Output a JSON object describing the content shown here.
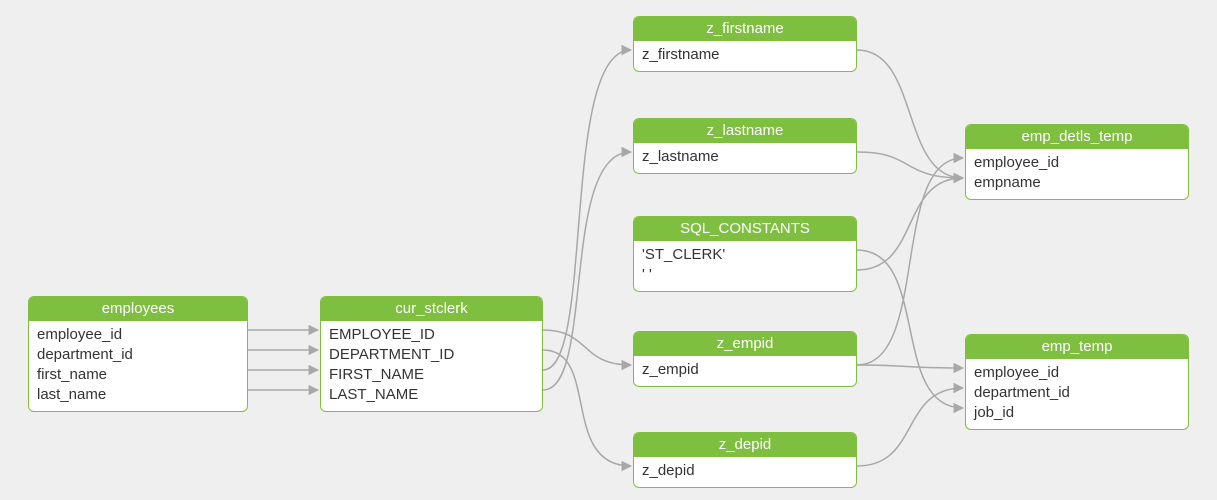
{
  "colors": {
    "node_header": "#7fbf3f",
    "node_border": "#7fbf3f",
    "connector": "#a8a8a8",
    "canvas_bg": "#efefef"
  },
  "nodes": {
    "employees": {
      "title": "employees",
      "fields": [
        "employee_id",
        "department_id",
        "first_name",
        "last_name"
      ]
    },
    "cur_stclerk": {
      "title": "cur_stclerk",
      "fields": [
        "EMPLOYEE_ID",
        "DEPARTMENT_ID",
        "FIRST_NAME",
        "LAST_NAME"
      ]
    },
    "z_firstname": {
      "title": "z_firstname",
      "fields": [
        "z_firstname"
      ]
    },
    "z_lastname": {
      "title": "z_lastname",
      "fields": [
        "z_lastname"
      ]
    },
    "sql_constants": {
      "title": "SQL_CONSTANTS",
      "fields": [
        "'ST_CLERK'",
        "' '"
      ]
    },
    "z_empid": {
      "title": "z_empid",
      "fields": [
        "z_empid"
      ]
    },
    "z_depid": {
      "title": "z_depid",
      "fields": [
        "z_depid"
      ]
    },
    "emp_detls_temp": {
      "title": "emp_detls_temp",
      "fields": [
        "employee_id",
        "empname"
      ]
    },
    "emp_temp": {
      "title": "emp_temp",
      "fields": [
        "employee_id",
        "department_id",
        "job_id"
      ]
    }
  },
  "edges": [
    {
      "from": "employees.employee_id",
      "to": "cur_stclerk.EMPLOYEE_ID"
    },
    {
      "from": "employees.department_id",
      "to": "cur_stclerk.DEPARTMENT_ID"
    },
    {
      "from": "employees.first_name",
      "to": "cur_stclerk.FIRST_NAME"
    },
    {
      "from": "employees.last_name",
      "to": "cur_stclerk.LAST_NAME"
    },
    {
      "from": "cur_stclerk.FIRST_NAME",
      "to": "z_firstname.z_firstname"
    },
    {
      "from": "cur_stclerk.LAST_NAME",
      "to": "z_lastname.z_lastname"
    },
    {
      "from": "cur_stclerk.EMPLOYEE_ID",
      "to": "z_empid.z_empid"
    },
    {
      "from": "cur_stclerk.DEPARTMENT_ID",
      "to": "z_depid.z_depid"
    },
    {
      "from": "z_firstname.z_firstname",
      "to": "emp_detls_temp.empname"
    },
    {
      "from": "z_lastname.z_lastname",
      "to": "emp_detls_temp.empname"
    },
    {
      "from": "sql_constants.' '",
      "to": "emp_detls_temp.empname"
    },
    {
      "from": "z_empid.z_empid",
      "to": "emp_detls_temp.employee_id"
    },
    {
      "from": "z_empid.z_empid",
      "to": "emp_temp.employee_id"
    },
    {
      "from": "z_depid.z_depid",
      "to": "emp_temp.department_id"
    },
    {
      "from": "sql_constants.'ST_CLERK'",
      "to": "emp_temp.job_id"
    }
  ]
}
